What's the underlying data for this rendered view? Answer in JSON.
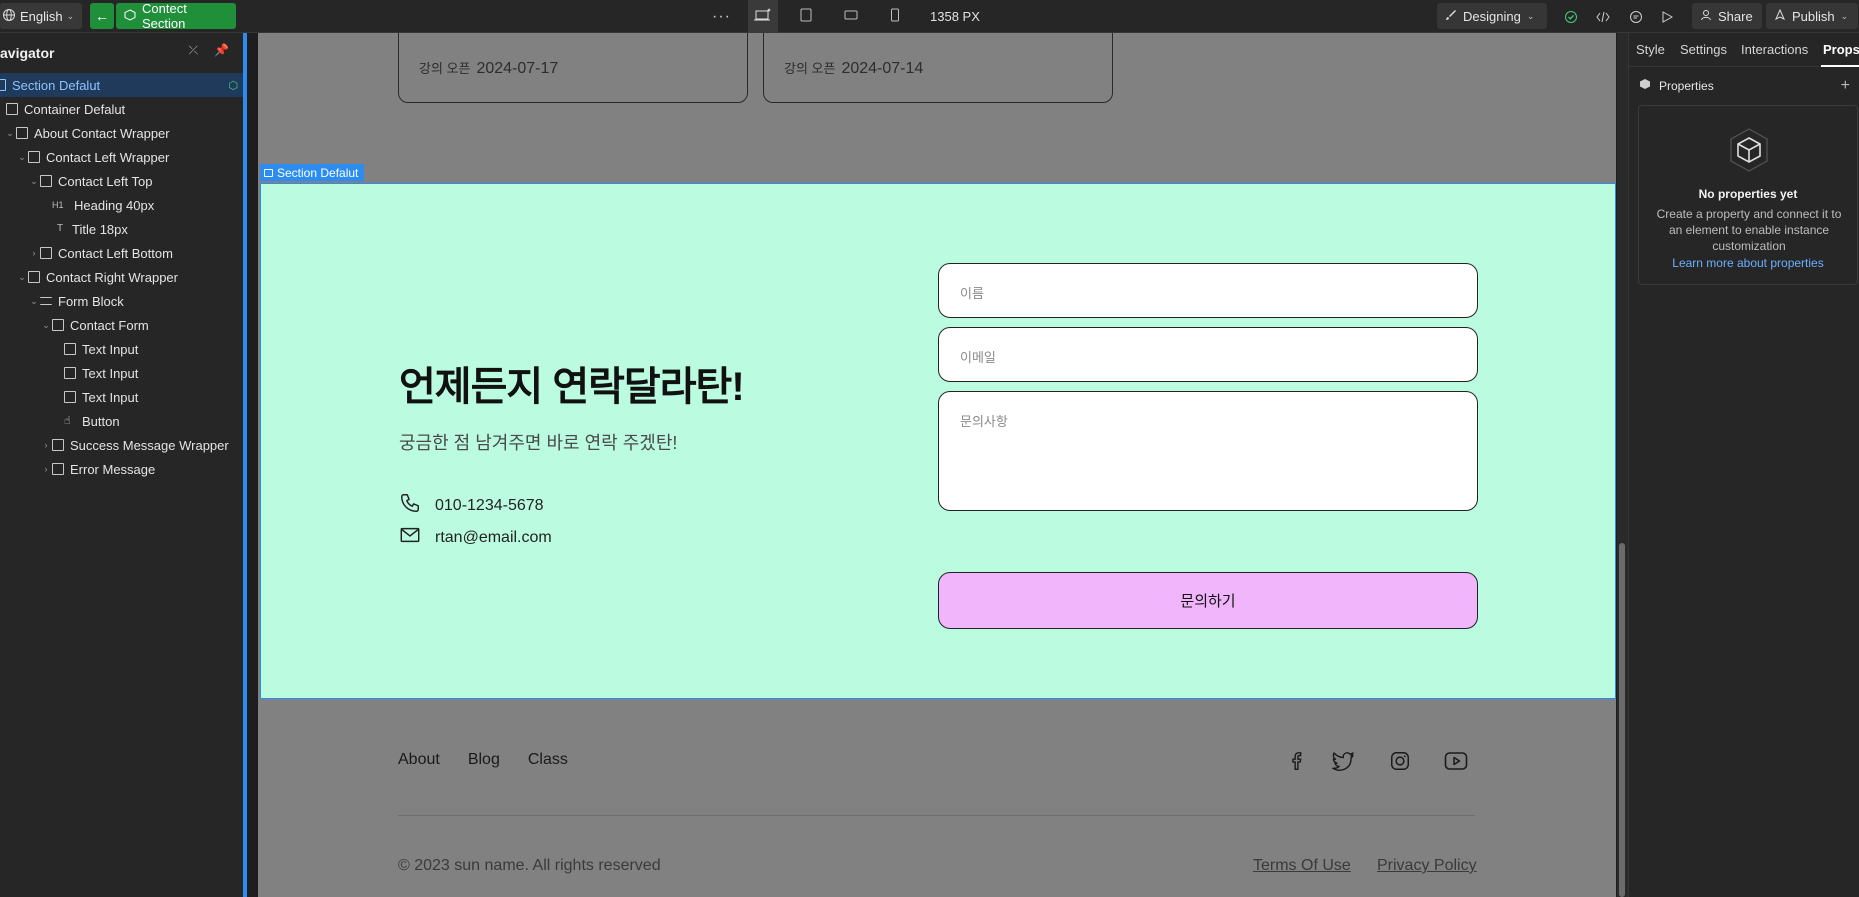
{
  "topbar": {
    "language": "English",
    "component_name": "Contect Section",
    "more": "···",
    "width_readout": "1358 PX",
    "mode": "Designing",
    "share": "Share",
    "publish": "Publish"
  },
  "navigator": {
    "title": "avigator",
    "items": [
      {
        "label": "Section Defalut"
      },
      {
        "label": "Container Defalut"
      },
      {
        "label": "About Contact Wrapper"
      },
      {
        "label": "Contact Left Wrapper"
      },
      {
        "label": "Contact Left Top"
      },
      {
        "label": "Heading 40px",
        "tag": "H1"
      },
      {
        "label": "Title 18px",
        "tag": "T"
      },
      {
        "label": "Contact  Left  Bottom"
      },
      {
        "label": "Contact Right Wrapper"
      },
      {
        "label": "Form Block"
      },
      {
        "label": "Contact Form"
      },
      {
        "label": "Text Input"
      },
      {
        "label": "Text Input"
      },
      {
        "label": "Text Input"
      },
      {
        "label": "Button"
      },
      {
        "label": "Success Message Wrapper"
      },
      {
        "label": "Error Message"
      }
    ]
  },
  "canvas": {
    "cards": [
      {
        "label": "강의 오픈",
        "date": "2024-07-17"
      },
      {
        "label": "강의 오픈",
        "date": "2024-07-14"
      }
    ],
    "section_label": "Section Defalut",
    "contact": {
      "heading": "언제든지 연락달라탄!",
      "subtitle": "궁금한 점 남겨주면 바로 연락 주겠탄!",
      "phone": "010-1234-5678",
      "email": "rtan@email.com",
      "name_placeholder": "이름",
      "email_placeholder": "이메일",
      "message_placeholder": "문의사항",
      "submit": "문의하기",
      "bg_color": "#bbfce0",
      "button_color": "#f0b5fb"
    },
    "footer": {
      "links": [
        "About",
        "Blog",
        "Class"
      ],
      "social_icons": [
        "facebook-icon",
        "twitter-icon",
        "instagram-icon",
        "youtube-icon"
      ],
      "copyright": "© 2023 sun name. All rights reserved",
      "terms": "Terms Of Use",
      "privacy": "Privacy Policy"
    }
  },
  "right_panel": {
    "tabs": [
      "Style",
      "Settings",
      "Interactions",
      "Props"
    ],
    "active_tab": "Props",
    "section_title": "Properties",
    "empty_title": "No properties yet",
    "empty_desc": "Create a property and connect it to an element to enable instance customization",
    "learn_link": "Learn more about properties"
  },
  "colors": {
    "accent_green": "#1f8f3a",
    "selection_blue": "#2c8cf0"
  }
}
